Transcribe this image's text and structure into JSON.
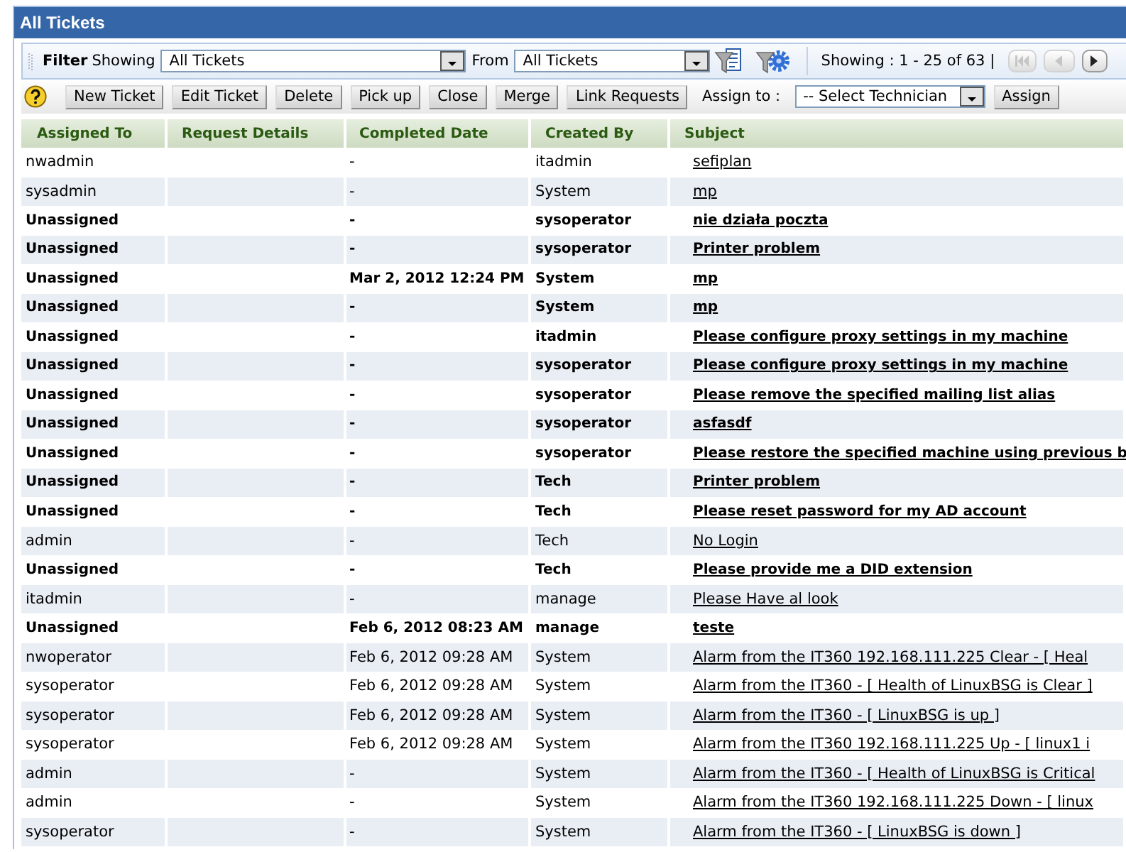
{
  "window": {
    "title": "All Tickets"
  },
  "filter_bar": {
    "title": "Filter",
    "showing_label": "Showing",
    "showing_value": "All Tickets",
    "from_label": "From",
    "from_value": "All Tickets",
    "paging_text": "Showing : 1 - 25 of 63 |",
    "pagination": [
      {
        "kind": "first",
        "disabled": true
      },
      {
        "kind": "previous",
        "disabled": true
      },
      {
        "kind": "next",
        "disabled": false
      }
    ]
  },
  "toolbar": {
    "buttons": [
      "New Ticket",
      "Edit Ticket",
      "Delete",
      "Pick up",
      "Close",
      "Merge",
      "Link Requests"
    ],
    "assign_label": "Assign to :",
    "technician_value": "-- Select Technician",
    "assign_button": "Assign"
  },
  "table": {
    "columns": [
      "Assigned To",
      "Request Details",
      "Completed Date",
      "Created By",
      "Subject"
    ],
    "rows": [
      {
        "bold": false,
        "assigned_to": "nwadmin",
        "completed_date": "-",
        "created_by": "itadmin",
        "subject": "sefiplan"
      },
      {
        "bold": false,
        "assigned_to": "sysadmin",
        "completed_date": "-",
        "created_by": "System",
        "subject": "mp"
      },
      {
        "bold": true,
        "assigned_to": "Unassigned",
        "completed_date": "-",
        "created_by": "sysoperator",
        "subject": "nie działa poczta"
      },
      {
        "bold": true,
        "assigned_to": "Unassigned",
        "completed_date": "-",
        "created_by": "sysoperator",
        "subject": "Printer problem"
      },
      {
        "bold": true,
        "assigned_to": "Unassigned",
        "completed_date": "Mar 2, 2012 12:24 PM",
        "created_by": "System",
        "subject": "mp"
      },
      {
        "bold": true,
        "assigned_to": "Unassigned",
        "completed_date": "-",
        "created_by": "System",
        "subject": "mp"
      },
      {
        "bold": true,
        "assigned_to": "Unassigned",
        "completed_date": "-",
        "created_by": "itadmin",
        "subject": "Please configure proxy settings in my machine"
      },
      {
        "bold": true,
        "assigned_to": "Unassigned",
        "completed_date": "-",
        "created_by": "sysoperator",
        "subject": "Please configure proxy settings in my machine"
      },
      {
        "bold": true,
        "assigned_to": "Unassigned",
        "completed_date": "-",
        "created_by": "sysoperator",
        "subject": "Please remove the specified mailing list alias"
      },
      {
        "bold": true,
        "assigned_to": "Unassigned",
        "completed_date": "-",
        "created_by": "sysoperator",
        "subject": "asfasdf"
      },
      {
        "bold": true,
        "assigned_to": "Unassigned",
        "completed_date": "-",
        "created_by": "sysoperator",
        "subject": "Please restore the specified machine using previous b"
      },
      {
        "bold": true,
        "assigned_to": "Unassigned",
        "completed_date": "-",
        "created_by": "Tech",
        "subject": "Printer problem"
      },
      {
        "bold": true,
        "assigned_to": "Unassigned",
        "completed_date": "-",
        "created_by": "Tech",
        "subject": "Please reset password for my AD account"
      },
      {
        "bold": false,
        "assigned_to": "admin",
        "completed_date": "-",
        "created_by": "Tech",
        "subject": "No Login"
      },
      {
        "bold": true,
        "assigned_to": "Unassigned",
        "completed_date": "-",
        "created_by": "Tech",
        "subject": "Please provide me a DID extension"
      },
      {
        "bold": false,
        "assigned_to": "itadmin",
        "completed_date": "-",
        "created_by": "manage",
        "subject": "Please Have al look"
      },
      {
        "bold": true,
        "assigned_to": "Unassigned",
        "completed_date": "Feb 6, 2012 08:23 AM",
        "created_by": "manage",
        "subject": "teste"
      },
      {
        "bold": false,
        "assigned_to": "nwoperator",
        "completed_date": "Feb 6, 2012 09:28 AM",
        "created_by": "System",
        "subject": "Alarm from the IT360 192.168.111.225 Clear - [ Heal"
      },
      {
        "bold": false,
        "assigned_to": "sysoperator",
        "completed_date": "Feb 6, 2012 09:28 AM",
        "created_by": "System",
        "subject": "Alarm from the IT360 - [ Health of LinuxBSG is Clear ]"
      },
      {
        "bold": false,
        "assigned_to": "sysoperator",
        "completed_date": "Feb 6, 2012 09:28 AM",
        "created_by": "System",
        "subject": "Alarm from the IT360 - [ LinuxBSG is up ]"
      },
      {
        "bold": false,
        "assigned_to": "sysoperator",
        "completed_date": "Feb 6, 2012 09:28 AM",
        "created_by": "System",
        "subject": "Alarm from the IT360 192.168.111.225 Up - [ linux1 i"
      },
      {
        "bold": false,
        "assigned_to": "admin",
        "completed_date": "-",
        "created_by": "System",
        "subject": "Alarm from the IT360 - [ Health of LinuxBSG is Critical"
      },
      {
        "bold": false,
        "assigned_to": "admin",
        "completed_date": "-",
        "created_by": "System",
        "subject": "Alarm from the IT360 192.168.111.225 Down - [ linux"
      },
      {
        "bold": false,
        "assigned_to": "sysoperator",
        "completed_date": "-",
        "created_by": "System",
        "subject": "Alarm from the IT360 - [ LinuxBSG is down ]"
      }
    ]
  }
}
